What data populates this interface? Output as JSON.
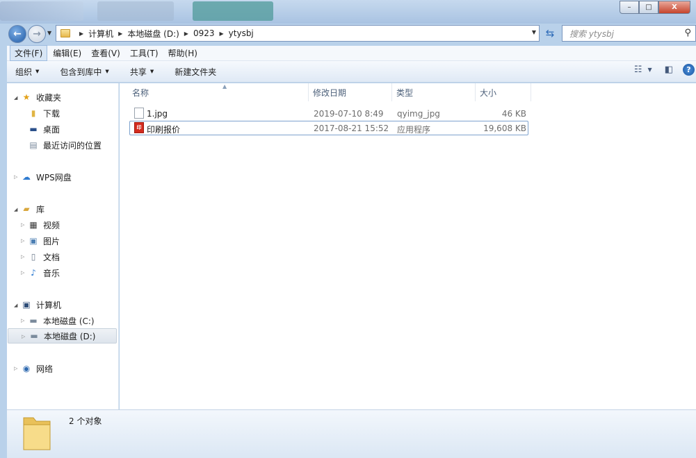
{
  "window": {
    "minimize": "–",
    "maximize": "□",
    "close": "X"
  },
  "address": {
    "crumbs": [
      "计算机",
      "本地磁盘 (D:)",
      "0923",
      "ytysbj"
    ]
  },
  "search": {
    "placeholder": "搜索 ytysbj"
  },
  "menu": {
    "items": [
      "文件(F)",
      "编辑(E)",
      "查看(V)",
      "工具(T)",
      "帮助(H)"
    ]
  },
  "toolbar": {
    "organize": "组织",
    "include": "包含到库中",
    "share": "共享",
    "new_folder": "新建文件夹"
  },
  "nav": {
    "favorites": "收藏夹",
    "downloads": "下载",
    "desktop": "桌面",
    "recent": "最近访问的位置",
    "wps": "WPS网盘",
    "libraries": "库",
    "videos": "视频",
    "pictures": "图片",
    "documents": "文档",
    "music": "音乐",
    "computer": "计算机",
    "drive_c": "本地磁盘 (C:)",
    "drive_d": "本地磁盘 (D:)",
    "network": "网络"
  },
  "columns": {
    "name": "名称",
    "date": "修改日期",
    "type": "类型",
    "size": "大小"
  },
  "files": [
    {
      "name": "1.jpg",
      "date": "2019-07-10 8:49",
      "type": "qyimg_jpg",
      "size": "46 KB"
    },
    {
      "name": "印刷报价",
      "date": "2017-08-21 15:52",
      "type": "应用程序",
      "size": "19,608 KB"
    }
  ],
  "app_icon_text": "印",
  "status": {
    "count": "2 个对象"
  }
}
